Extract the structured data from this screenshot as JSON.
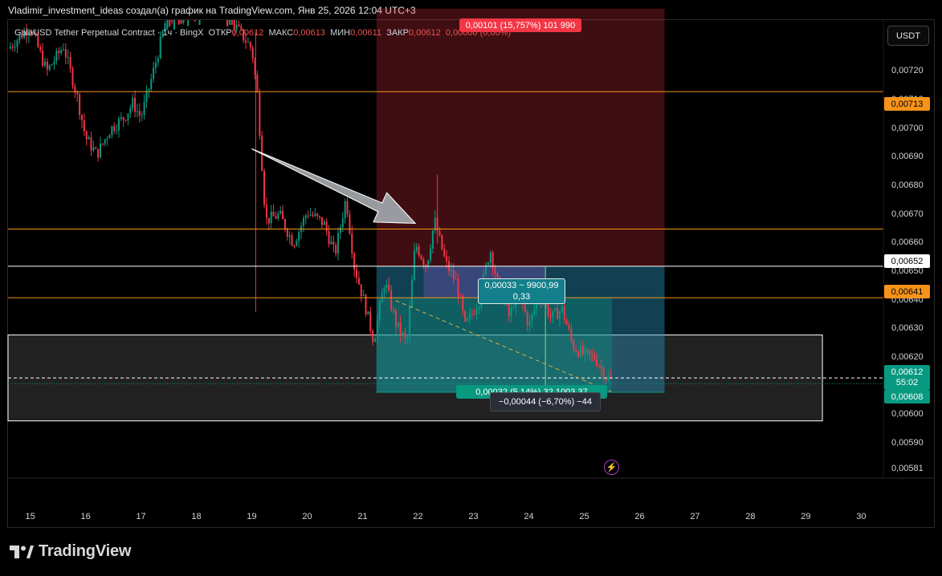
{
  "header": {
    "author_line": "Vladimir_investment_ideas создал(а) график на TradingView.com, Янв 25, 2026 12:04 UTC+3"
  },
  "legend": {
    "symbol": "GalaUSD Tether Perpetual Contract · 1ч · BingX",
    "open_label": "ОТКР",
    "open": "0,00612",
    "high_label": "МАКС",
    "high": "0,00613",
    "low_label": "МИН",
    "low": "0,00611",
    "close_label": "ЗАКР",
    "close": "0,00612",
    "change": "0,00000 (0,00%)"
  },
  "currency_button": "USDT",
  "brand": {
    "name": "TradingView"
  },
  "price_tags": {
    "resistance": {
      "label": "0,00713",
      "color": "#f7931a"
    },
    "white_line": {
      "label": "0,00652",
      "color": "#ffffff"
    },
    "entry": {
      "label": "0,00641",
      "color": "#f7931a"
    },
    "current": {
      "label": "0,00612",
      "countdown": "55:02",
      "color": "#089981"
    },
    "target": {
      "label": "0,00608",
      "color": "#089981"
    }
  },
  "annotations": {
    "risk_label": "0,00101 (15,757%) 101 990",
    "measure_label_1": "0,00033 ~ 9900,99",
    "measure_label_2": "0,33",
    "reward_label": "0,00032 (5,14%) 32 1003,37",
    "range_label": "−0,00044 (−6,70%) −44"
  },
  "chart_data": {
    "type": "candlestick",
    "title": "",
    "xlabel": "",
    "ylabel": "",
    "x_ticks": [
      "15",
      "16",
      "17",
      "18",
      "19",
      "20",
      "21",
      "22",
      "23",
      "24",
      "25",
      "26",
      "27",
      "28",
      "29",
      "30"
    ],
    "y_ticks": [
      "0,00720",
      "0,00710",
      "0,00700",
      "0,00690",
      "0,00680",
      "0,00670",
      "0,00660",
      "0,00650",
      "0,00640",
      "0,00630",
      "0,00620",
      "0,00610",
      "0,00600",
      "0,00590",
      "0,00581"
    ],
    "ylim": [
      0.00578,
      0.00738
    ],
    "xlim": [
      14.6,
      30.4
    ],
    "horizontal_levels": [
      {
        "price": 0.00713,
        "color": "#f7931a"
      },
      {
        "price": 0.00665,
        "color": "#f7931a"
      },
      {
        "price": 0.00652,
        "color": "#ffffff"
      },
      {
        "price": 0.00641,
        "color": "#f7931a"
      }
    ],
    "support_zone": {
      "from": 0.00598,
      "to": 0.00628,
      "x_start": 14.6,
      "x_end": 29.3
    },
    "current_price_line": 0.00613,
    "position_tool": {
      "x_start": 21.25,
      "x_end": 26.45,
      "entry": 0.00652,
      "stop": 0.00742,
      "target": 0.00608
    },
    "trend_arrow": {
      "from": [
        19.0,
        0.00693
      ],
      "to": [
        21.95,
        0.00667
      ]
    },
    "series": [
      {
        "name": "",
        "colors": {
          "up": "#089981",
          "down": "#f23645"
        },
        "anchors": [
          [
            14.6,
            0.00728
          ],
          [
            15.0,
            0.00736
          ],
          [
            15.3,
            0.0072
          ],
          [
            15.6,
            0.00729
          ],
          [
            15.85,
            0.00711
          ],
          [
            16.0,
            0.00697
          ],
          [
            16.2,
            0.00691
          ],
          [
            16.45,
            0.007
          ],
          [
            16.7,
            0.00704
          ],
          [
            16.85,
            0.00709
          ],
          [
            17.0,
            0.00704
          ],
          [
            17.25,
            0.00722
          ],
          [
            17.45,
            0.00738
          ],
          [
            18.4,
            0.00744
          ],
          [
            19.0,
            0.00728
          ],
          [
            19.1,
            0.00712
          ],
          [
            19.25,
            0.00668
          ],
          [
            19.5,
            0.0067
          ],
          [
            19.75,
            0.0066
          ],
          [
            20.0,
            0.00671
          ],
          [
            20.3,
            0.00667
          ],
          [
            20.5,
            0.00656
          ],
          [
            20.7,
            0.00676
          ],
          [
            20.85,
            0.00652
          ],
          [
            21.05,
            0.00638
          ],
          [
            21.2,
            0.00626
          ],
          [
            21.4,
            0.00647
          ],
          [
            21.6,
            0.00632
          ],
          [
            21.8,
            0.00625
          ],
          [
            21.95,
            0.0066
          ],
          [
            22.15,
            0.00652
          ],
          [
            22.3,
            0.00668
          ],
          [
            22.5,
            0.00653
          ],
          [
            22.7,
            0.00646
          ],
          [
            22.85,
            0.00631
          ],
          [
            23.1,
            0.0064
          ],
          [
            23.3,
            0.00658
          ],
          [
            23.45,
            0.00645
          ],
          [
            23.65,
            0.00634
          ],
          [
            23.8,
            0.00645
          ],
          [
            24.0,
            0.00631
          ],
          [
            24.2,
            0.00643
          ],
          [
            24.4,
            0.00634
          ],
          [
            24.6,
            0.00637
          ],
          [
            24.8,
            0.00624
          ],
          [
            25.0,
            0.00621
          ],
          [
            25.2,
            0.0062
          ],
          [
            25.4,
            0.00613
          ],
          [
            25.5,
            0.00612
          ]
        ]
      }
    ]
  }
}
